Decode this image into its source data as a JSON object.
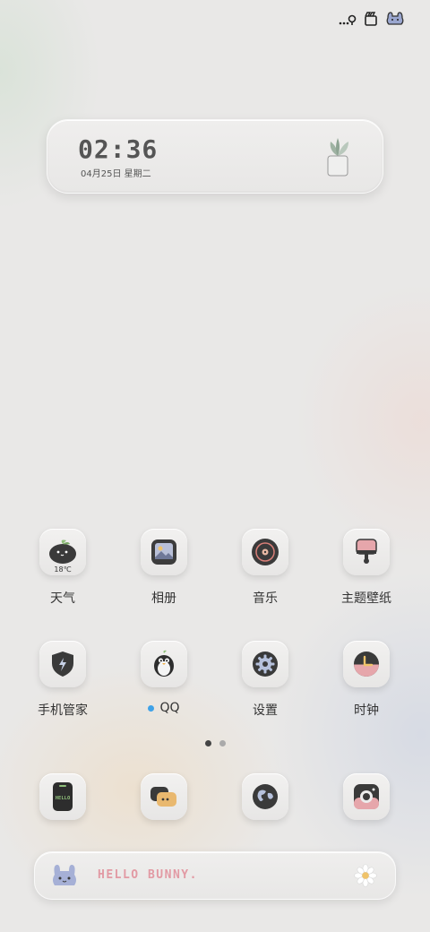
{
  "status_bar": {
    "icons": [
      "signal-dots-icon",
      "film-clapper-icon",
      "bunny-face-icon"
    ]
  },
  "clock_widget": {
    "time": "02:36",
    "date": "04月25日 星期二",
    "icon": "potted-plant-icon"
  },
  "apps_row1": [
    {
      "label": "天气",
      "icon": "weather-tomato-icon",
      "temp": "18℃"
    },
    {
      "label": "相册",
      "icon": "gallery-picture-icon"
    },
    {
      "label": "音乐",
      "icon": "vinyl-record-icon"
    },
    {
      "label": "主题壁纸",
      "icon": "paint-roller-icon"
    }
  ],
  "apps_row2": [
    {
      "label": "手机管家",
      "icon": "shield-bolt-icon"
    },
    {
      "label": "QQ",
      "icon": "penguin-icon",
      "badge_color": "#3ea2e8"
    },
    {
      "label": "设置",
      "icon": "gear-icon"
    },
    {
      "label": "时钟",
      "icon": "clock-icon"
    }
  ],
  "page_indicator": {
    "count": 2,
    "active": 1
  },
  "dock": [
    {
      "icon": "phone-hello-icon",
      "text": "HELLO"
    },
    {
      "icon": "chat-bubbles-icon"
    },
    {
      "icon": "browser-globe-icon"
    },
    {
      "icon": "camera-icon"
    }
  ],
  "banner": {
    "text": "HELLO BUNNY.",
    "left_icon": "bunny-icon",
    "right_icon": "daisy-flower-icon",
    "text_color": "#e29aa4"
  }
}
